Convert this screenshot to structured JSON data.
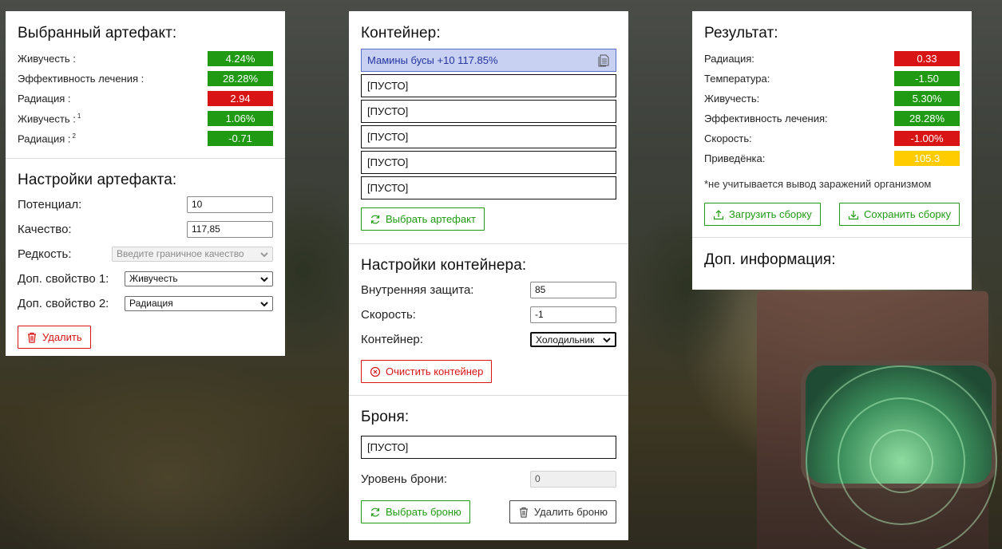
{
  "artifact_panel": {
    "title": "Выбранный артефакт:",
    "stats": [
      {
        "label": "Живучесть :",
        "sup": "",
        "value": "4.24%",
        "color": "green"
      },
      {
        "label": "Эффективность лечения :",
        "sup": "",
        "value": "28.28%",
        "color": "green"
      },
      {
        "label": "Радиация :",
        "sup": "",
        "value": "2.94",
        "color": "red"
      },
      {
        "label": "Живучесть :",
        "sup": "1",
        "value": "1.06%",
        "color": "green"
      },
      {
        "label": "Радиация :",
        "sup": "2",
        "value": "-0.71",
        "color": "green"
      }
    ],
    "settings_title": "Настройки артефакта:",
    "potential_label": "Потенциал:",
    "potential_value": "10",
    "quality_label": "Качество:",
    "quality_value": "117,85",
    "rarity_label": "Редкость:",
    "rarity_placeholder": "Введите граничное качество",
    "extra1_label": "Доп. свойство 1:",
    "extra1_value": "Живучесть",
    "extra2_label": "Доп. свойство 2:",
    "extra2_value": "Радиация",
    "delete_label": "Удалить"
  },
  "container_panel": {
    "title": "Контейнер:",
    "slots": [
      "Мамины бусы +10 117.85%",
      "[ПУСТО]",
      "[ПУСТО]",
      "[ПУСТО]",
      "[ПУСТО]",
      "[ПУСТО]"
    ],
    "select_artifact_label": "Выбрать артефакт",
    "settings_title": "Настройки контейнера:",
    "inner_protection_label": "Внутренняя защита:",
    "inner_protection_value": "85",
    "speed_label": "Скорость:",
    "speed_value": "-1",
    "container_label": "Контейнер:",
    "container_value": "Холодильник",
    "clear_label": "Очистить контейнер",
    "armor_title": "Броня:",
    "armor_slot": "[ПУСТО]",
    "armor_level_label": "Уровень брони:",
    "armor_level_value": "0",
    "select_armor_label": "Выбрать броню",
    "delete_armor_label": "Удалить броню"
  },
  "result_panel": {
    "title": "Результат:",
    "stats": [
      {
        "label": "Радиация:",
        "value": "0.33",
        "color": "red"
      },
      {
        "label": "Температура:",
        "value": "-1.50",
        "color": "green"
      },
      {
        "label": "Живучесть:",
        "value": "5.30%",
        "color": "green"
      },
      {
        "label": "Эффективность лечения:",
        "value": "28.28%",
        "color": "green"
      },
      {
        "label": "Скорость:",
        "value": "-1.00%",
        "color": "red"
      },
      {
        "label": "Приведёнка:",
        "value": "105.3",
        "color": "yellow"
      }
    ],
    "note": "*не учитывается вывод заражений организмом",
    "load_label": "Загрузить сборку",
    "save_label": "Сохранить сборку",
    "info_title": "Доп. информация:"
  },
  "colors": {
    "green": "#1f9a12",
    "red": "#d81414",
    "yellow": "#ffcc00",
    "selected_slot": "#c8d1f2"
  }
}
